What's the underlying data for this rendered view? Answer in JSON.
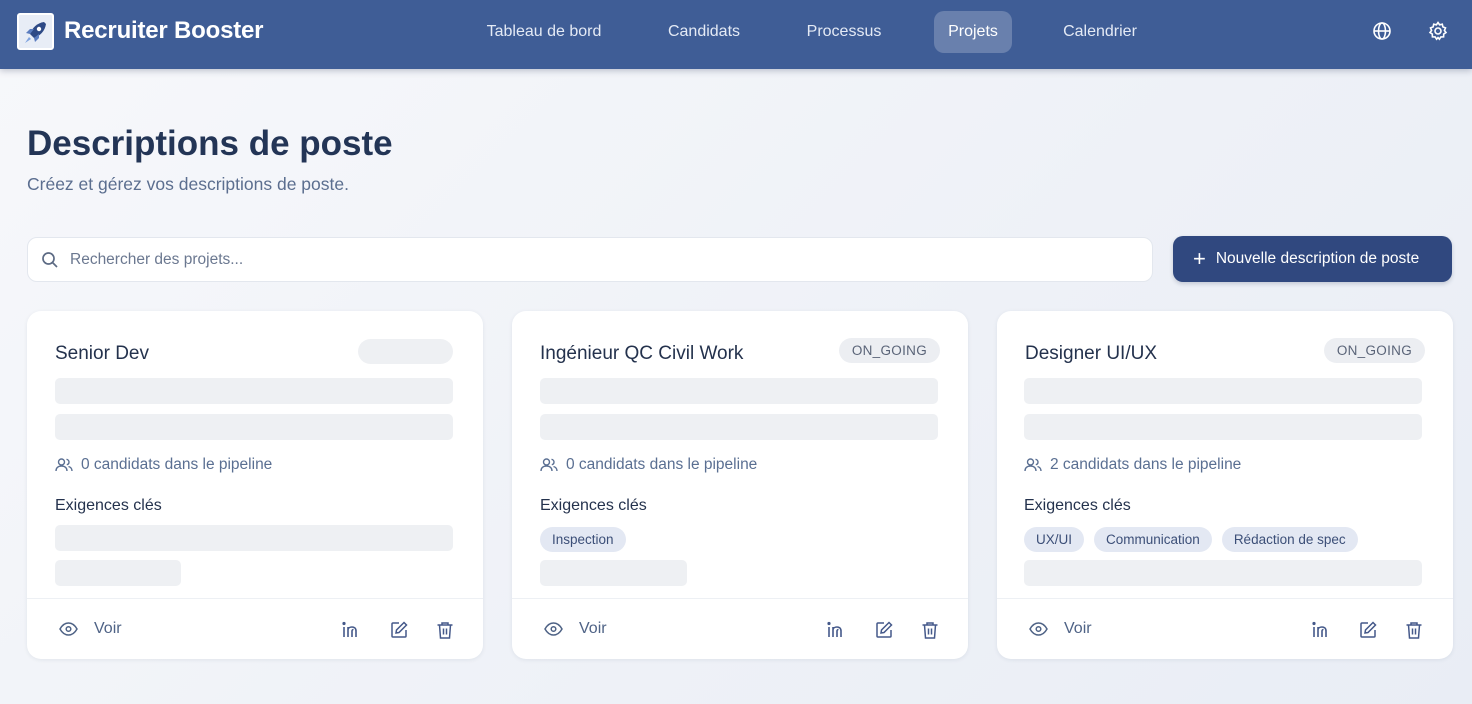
{
  "app": {
    "name": "Recruiter Booster"
  },
  "nav": {
    "items": [
      {
        "label": "Tableau de bord",
        "active": false
      },
      {
        "label": "Candidats",
        "active": false
      },
      {
        "label": "Processus",
        "active": false
      },
      {
        "label": "Projets",
        "active": true
      },
      {
        "label": "Calendrier",
        "active": false
      }
    ],
    "icons": [
      "globe-icon",
      "gear-icon"
    ]
  },
  "header": {
    "title": "Descriptions de poste",
    "subtitle": "Créez et gérez vos descriptions de poste."
  },
  "search": {
    "placeholder": "Rechercher des projets...",
    "value": ""
  },
  "new_button": {
    "label": "Nouvelle description de poste"
  },
  "cards": [
    {
      "title": "Senior Dev",
      "status": "",
      "pipeline": "0 candidats dans le pipeline",
      "requirements_title": "Exigences clés",
      "tags": [],
      "view_label": "Voir"
    },
    {
      "title": "Ingénieur QC Civil Work",
      "status": "ON_GOING",
      "pipeline": "0 candidats dans le pipeline",
      "requirements_title": "Exigences clés",
      "tags": [
        "Inspection"
      ],
      "view_label": "Voir"
    },
    {
      "title": "Designer UI/UX",
      "status": "ON_GOING",
      "pipeline": "2 candidats dans le pipeline",
      "requirements_title": "Exigences clés",
      "tags": [
        "UX/UI",
        "Communication",
        "Rédaction de spec"
      ],
      "view_label": "Voir"
    }
  ],
  "colors": {
    "navbar": "#3f5d96",
    "primary_button": "#30487f",
    "tag_bg": "#e3e8f3"
  }
}
